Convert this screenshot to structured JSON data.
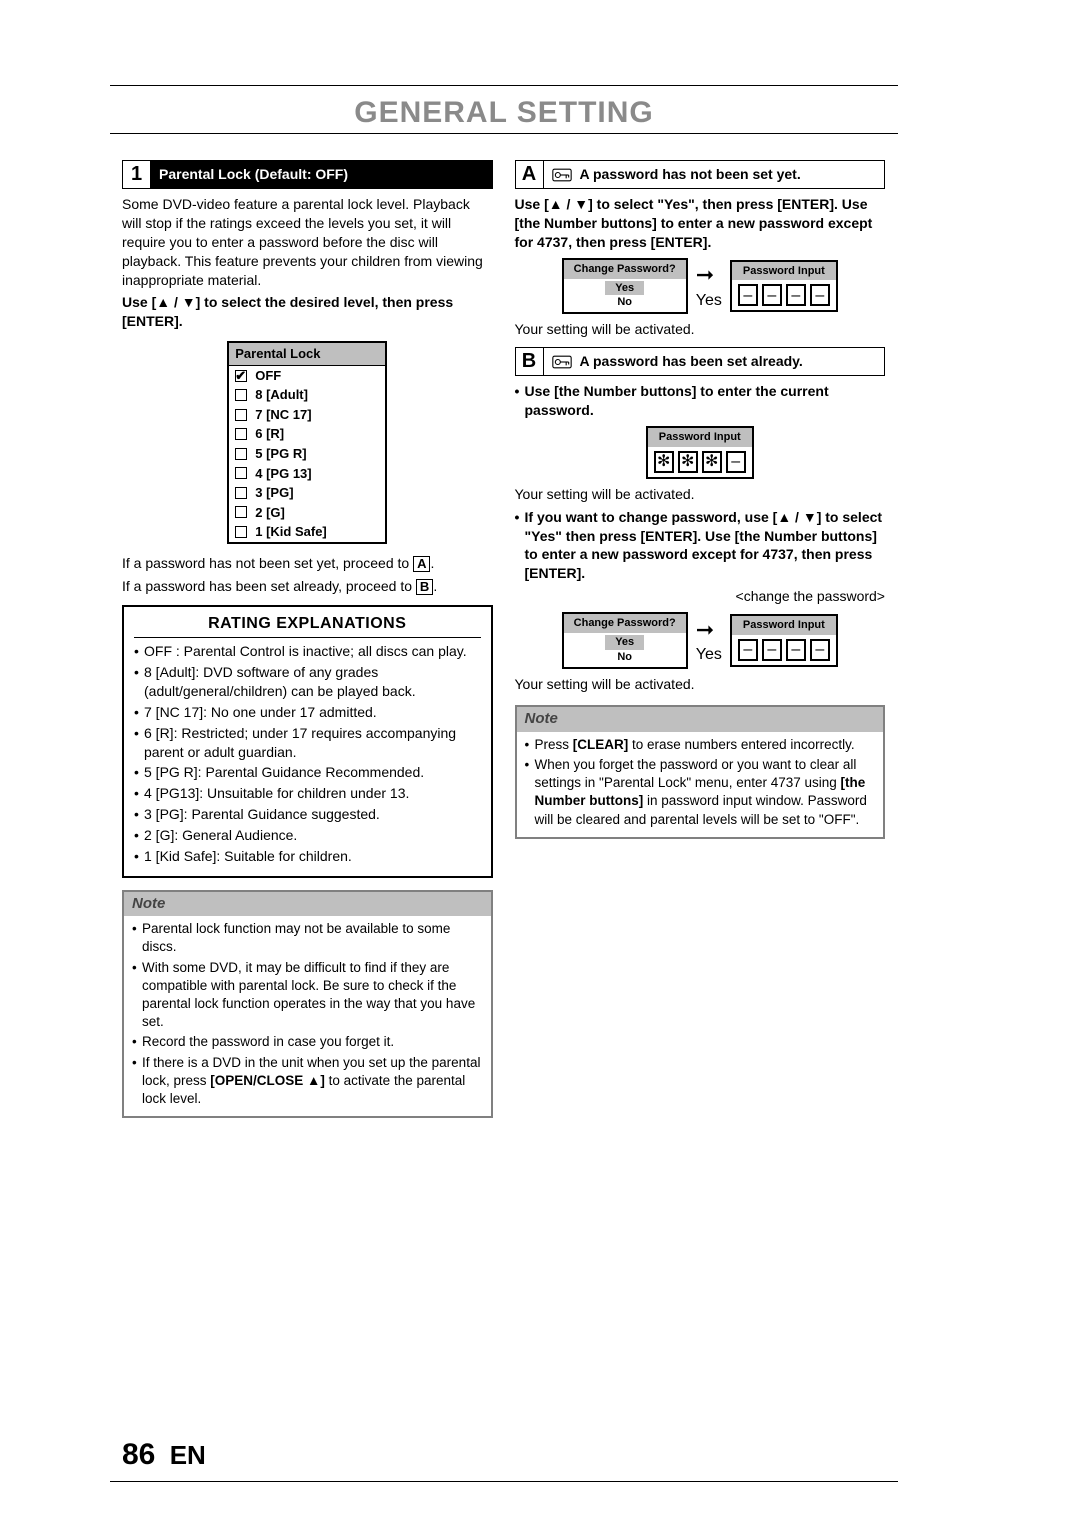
{
  "page_title": "GENERAL SETTING",
  "page_number": "86",
  "page_lang": "EN",
  "step1": {
    "num": "1",
    "label": "Parental Lock (Default: OFF)",
    "intro": "Some DVD-video feature a parental lock level. Playback will stop if the ratings exceed the levels you set, it will require you to enter a password before the disc will playback. This feature prevents your children from viewing inappropriate material.",
    "instruction_pre": "Use [",
    "instruction_post": "] to select the desired level, then press [ENTER].",
    "menu_title": "Parental Lock",
    "levels": [
      "OFF",
      "8 [Adult]",
      "7 [NC 17]",
      "6 [R]",
      "5 [PG R]",
      "4 [PG 13]",
      "3 [PG]",
      "2 [G]",
      "1 [Kid Safe]"
    ],
    "after1_pre": "If a password has not been set yet, proceed to ",
    "after1_box": "A",
    "after1_post": ".",
    "after2_pre": "If a password has been set already, proceed to ",
    "after2_box": "B",
    "after2_post": "."
  },
  "ratings": {
    "title": "RATING EXPLANATIONS",
    "items": [
      "OFF : Parental Control is inactive; all discs can play.",
      "8 [Adult]: DVD software of any grades (adult/general/children) can be played back.",
      "7 [NC 17]: No one under 17 admitted.",
      "6 [R]: Restricted; under 17 requires accompanying parent or adult guardian.",
      "5 [PG R]: Parental Guidance Recommended.",
      "4 [PG13]: Unsuitable for children under 13.",
      "3 [PG]: Parental Guidance suggested.",
      "2 [G]: General Audience.",
      "1 [Kid Safe]: Suitable for children."
    ]
  },
  "note_left": {
    "title": "Note",
    "items": [
      "Parental lock function may not be available to some discs.",
      "With some DVD, it may be difficult to find if they are compatible with parental lock. Be sure to check if the parental lock function operates in the way that you have set.",
      "Record the password in case you forget it.",
      "If there is a DVD in the unit when you set up the parental lock, press <b>[OPEN/CLOSE ▲]</b> to activate the parental lock level."
    ]
  },
  "A": {
    "letter": "A",
    "text": "A password has not been set yet.",
    "instruction": "Use [▲ / ▼] to select \"Yes\", then press [ENTER]. Use [the Number buttons] to enter a new password except for 4737, then press [ENTER].",
    "dlg_change": "Change Password?",
    "dlg_yes": "Yes",
    "dlg_no": "No",
    "mid_yes": "Yes",
    "dlg_pw": "Password Input",
    "after": "Your setting will be activated."
  },
  "B": {
    "letter": "B",
    "text": "A password has been set already.",
    "instruction": "Use [the Number buttons] to enter the current password.",
    "dlg_pw": "Password Input",
    "after": "Your setting will be activated.",
    "change_instruction": "If you want to change password, use [▲ / ▼] to select \"Yes\" then press [ENTER]. Use [the Number buttons] to enter a new password except for 4737, then press [ENTER].",
    "change_caption": "<change the password>",
    "dlg_change": "Change Password?",
    "dlg_yes": "Yes",
    "dlg_no": "No",
    "mid_yes": "Yes",
    "after2": "Your setting will be activated."
  },
  "note_right": {
    "title": "Note",
    "items": [
      "Press <b>[CLEAR]</b> to erase numbers entered incorrectly.",
      "When you forget the password or you want to clear all settings in \"Parental Lock\" menu, enter 4737 using <b>[the Number buttons]</b> in password input window. Password will be cleared and parental levels will be set to \"OFF\"."
    ]
  },
  "symbols": {
    "updown": "▲ / ▼",
    "arrow_right": "➞",
    "dash": "–",
    "star": "✻"
  }
}
